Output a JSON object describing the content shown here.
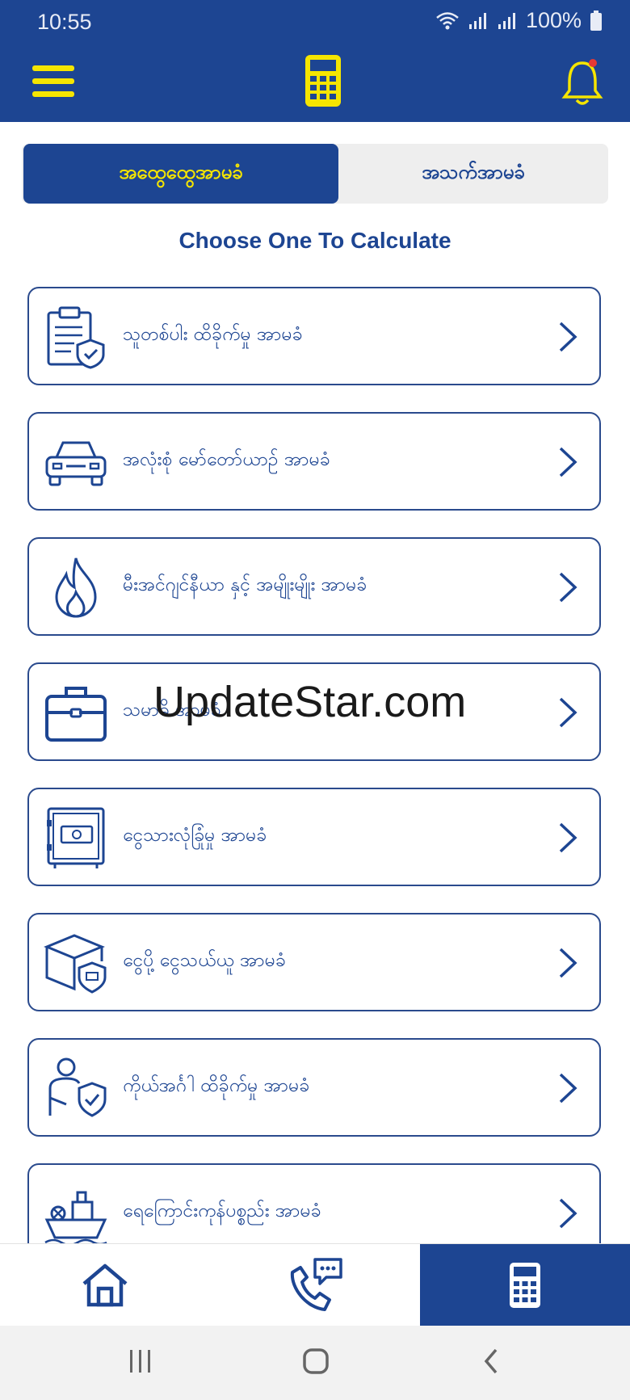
{
  "status_bar": {
    "time": "10:55",
    "battery": "100%"
  },
  "tabs": [
    {
      "label": "အထွေထွေအာမခံ",
      "active": true
    },
    {
      "label": "အသက်အာမခံ",
      "active": false
    }
  ],
  "heading": "Choose One To Calculate",
  "items": [
    {
      "label": "သူတစ်ပါး ထိခိုက်မှု အာမခံ",
      "icon": "clipboard-shield-icon"
    },
    {
      "label": "အလုံးစုံ မော်တော်ယာဥ် အာမခံ",
      "icon": "car-icon"
    },
    {
      "label": "မီးအင်ဂျင်နီယာ နှင့် အမျိုးမျိုး အာမခံ",
      "icon": "flame-icon"
    },
    {
      "label": "သမာဓိ အာမခံ",
      "icon": "briefcase-icon"
    },
    {
      "label": "ငွေသားလုံခြုံမှု အာမခံ",
      "icon": "safe-icon"
    },
    {
      "label": "ငွေပို့ ငွေသယ်ယူ အာမခံ",
      "icon": "box-shield-icon"
    },
    {
      "label": "ကိုယ်အင်္ဂါ ထိခိုက်မှု အာမခံ",
      "icon": "person-shield-icon"
    },
    {
      "label": "ရေကြောင်းကုန်ပစ္စည်း အာမခံ",
      "icon": "ship-icon"
    }
  ],
  "watermark": "UpdateStar.com",
  "colors": {
    "primary": "#1d4592",
    "accent": "#f5e500",
    "card_border": "#2a4a8d"
  }
}
